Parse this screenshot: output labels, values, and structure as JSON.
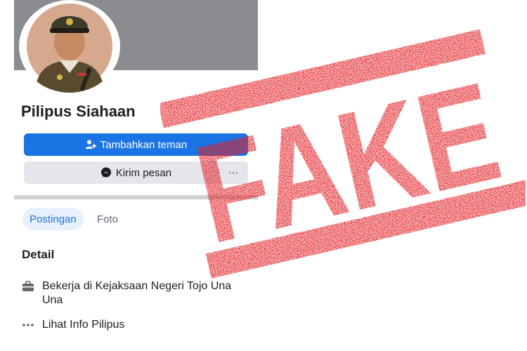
{
  "profile": {
    "name": "Pilipus Siahaan"
  },
  "buttons": {
    "add_friend": "Tambahkan teman",
    "message": "Kirim pesan",
    "more": "···"
  },
  "tabs": [
    {
      "label": "Postingan",
      "active": true
    },
    {
      "label": "Foto",
      "active": false
    }
  ],
  "detail": {
    "title": "Detail",
    "items": [
      {
        "icon": "briefcase-icon",
        "text": "Bekerja di Kejaksaan Negeri Tojo Una Una"
      },
      {
        "icon": "more-dots-icon",
        "text": "Lihat Info Pilipus"
      }
    ]
  },
  "stamp": {
    "text": "FAKE",
    "color": "#e31e24"
  },
  "colors": {
    "accent": "#1b74e4",
    "secondary_button": "#e4e6eb",
    "cover": "#8a8c90"
  }
}
